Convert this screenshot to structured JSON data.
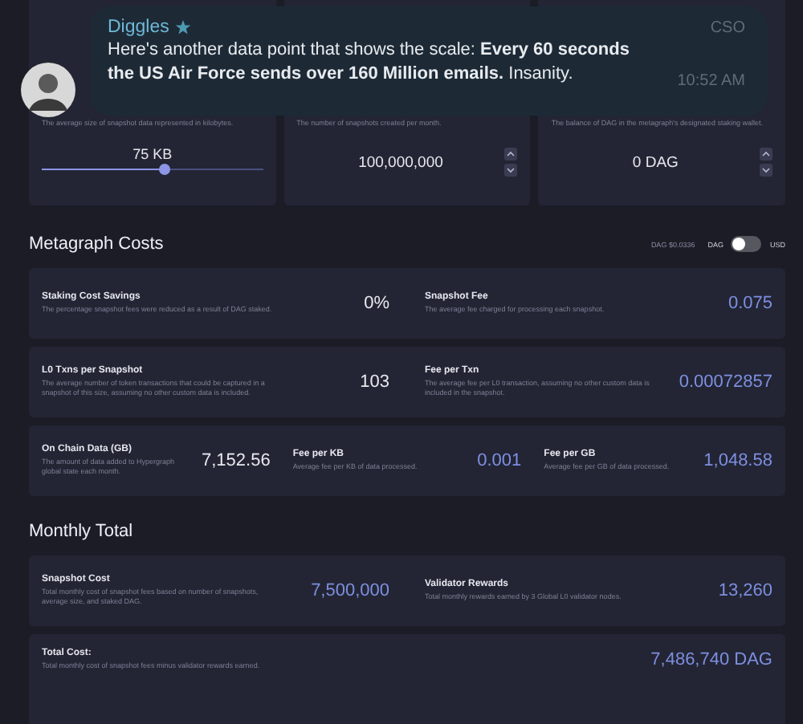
{
  "top_cards": [
    {
      "description": "The average size of snapshot data represented in kilobytes.",
      "kind": "slider",
      "value": "75 KB",
      "level": 0.56
    },
    {
      "description": "The number of snapshots created per month.",
      "kind": "stepper",
      "value": "100,000,000"
    },
    {
      "description": "The balance of DAG in the metagraph's designated staking wallet.",
      "kind": "stepper",
      "value": "0 DAG"
    }
  ],
  "metagraph_costs": {
    "title": "Metagraph Costs",
    "dag_price": "DAG $0.0336",
    "toggle": {
      "left_label": "DAG",
      "right_label": "USD",
      "on": false
    },
    "rows": [
      [
        {
          "title": "Staking Cost Savings",
          "description": "The percentage snapshot fees were reduced as a result of DAG staked.",
          "value": "0%",
          "highlight": false
        },
        {
          "title": "Snapshot Fee",
          "description": "The average fee charged for processing each snapshot.",
          "value": "0.075",
          "highlight": true
        }
      ],
      [
        {
          "title": "L0 Txns per Snapshot",
          "description": "The average number of token transactions that could be captured in a snapshot of this size, assuming no other custom data is included.",
          "value": "103",
          "highlight": false
        },
        {
          "title": "Fee per Txn",
          "description": "The average fee per L0 transaction, assuming no other custom data is included in the snapshot.",
          "value": "0.00072857",
          "highlight": true
        }
      ],
      [
        {
          "title": "On Chain Data (GB)",
          "description": "The amount of data added to Hypergraph global state each month.",
          "value": "7,152.56",
          "highlight": false
        },
        {
          "title": "Fee per KB",
          "description": "Average fee per KB of data processed.",
          "value": "0.001",
          "highlight": true
        },
        {
          "title": "Fee per GB",
          "description": "Average fee per GB of data processed.",
          "value": "1,048.58",
          "highlight": true
        }
      ]
    ]
  },
  "monthly_total": {
    "title": "Monthly Total",
    "rows": [
      [
        {
          "title": "Snapshot Cost",
          "description": "Total monthly cost of snapshot fees based on number of snapshots, average size, and staked DAG.",
          "value": "7,500,000",
          "highlight": true
        },
        {
          "title": "Validator Rewards",
          "description": "Total monthly rewards earned by 3 Global L0 validator nodes.",
          "value": "13,260",
          "highlight": true
        }
      ],
      [
        {
          "title": "Total Cost:",
          "description": "Total monthly cost of snapshot fees minus validator rewards earned.",
          "value": "7,486,740 DAG",
          "highlight": true
        }
      ]
    ]
  },
  "message": {
    "sender": "Diggles",
    "role": "CSO",
    "text": "Here's another data point that shows the scale: **Every 60 seconds the US Air Force sends over 160 Million emails.** Insanity.",
    "time": "10:52 AM"
  }
}
